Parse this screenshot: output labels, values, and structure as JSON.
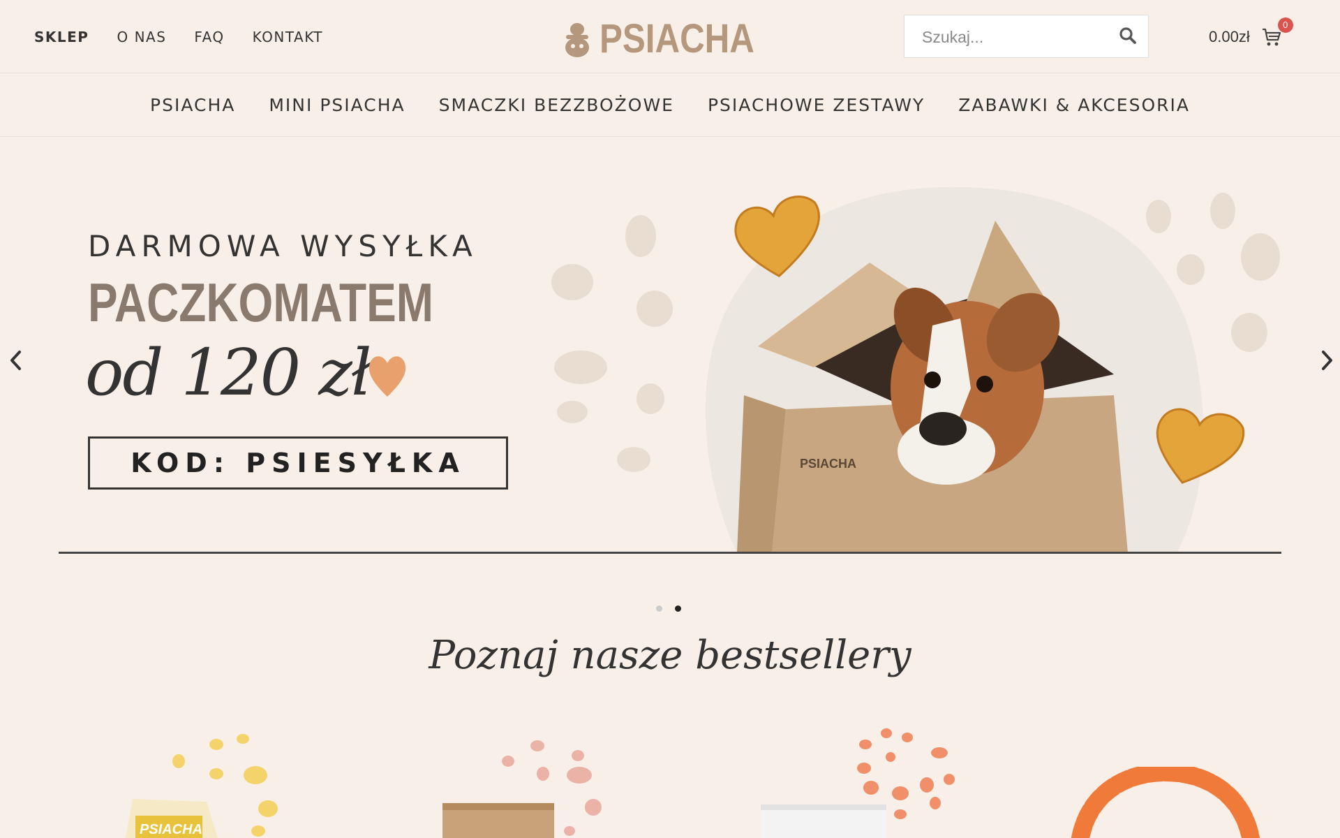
{
  "header": {
    "top_links": [
      {
        "label": "SKLEP",
        "active": true
      },
      {
        "label": "O NAS",
        "active": false
      },
      {
        "label": "FAQ",
        "active": false
      },
      {
        "label": "KONTAKT",
        "active": false
      }
    ],
    "logo_text": "PSIACHA",
    "search": {
      "placeholder": "Szukaj..."
    },
    "cart": {
      "total": "0.00zł",
      "count": "0"
    }
  },
  "main_nav": [
    {
      "label": "PSIACHA"
    },
    {
      "label": "MINI PSIACHA"
    },
    {
      "label": "SMACZKI BEZZBOŻOWE"
    },
    {
      "label": "PSIACHOWE ZESTAWY"
    },
    {
      "label": "ZABAWKI & AKCESORIA"
    }
  ],
  "hero": {
    "line1": "DARMOWA WYSYŁKA",
    "line2": "PACZKOMATEM",
    "line3": "od 120 zł",
    "code": "KOD: PSIESYŁKA",
    "box_label": "PSIACHA",
    "active_slide": 2,
    "slide_count": 2
  },
  "bestsellers": {
    "title": "Poznaj nasze bestsellery",
    "product_card_label": "PSIACHA"
  },
  "colors": {
    "background": "#f8f0e8",
    "logo": "#b4977c",
    "badge": "#d9534f",
    "heart": "#e8a06c",
    "toy": "#f07a3a"
  },
  "icons": [
    "search-icon",
    "cart-icon",
    "chevron-left-icon",
    "chevron-right-icon",
    "heart-icon",
    "dog-logo-icon"
  ]
}
